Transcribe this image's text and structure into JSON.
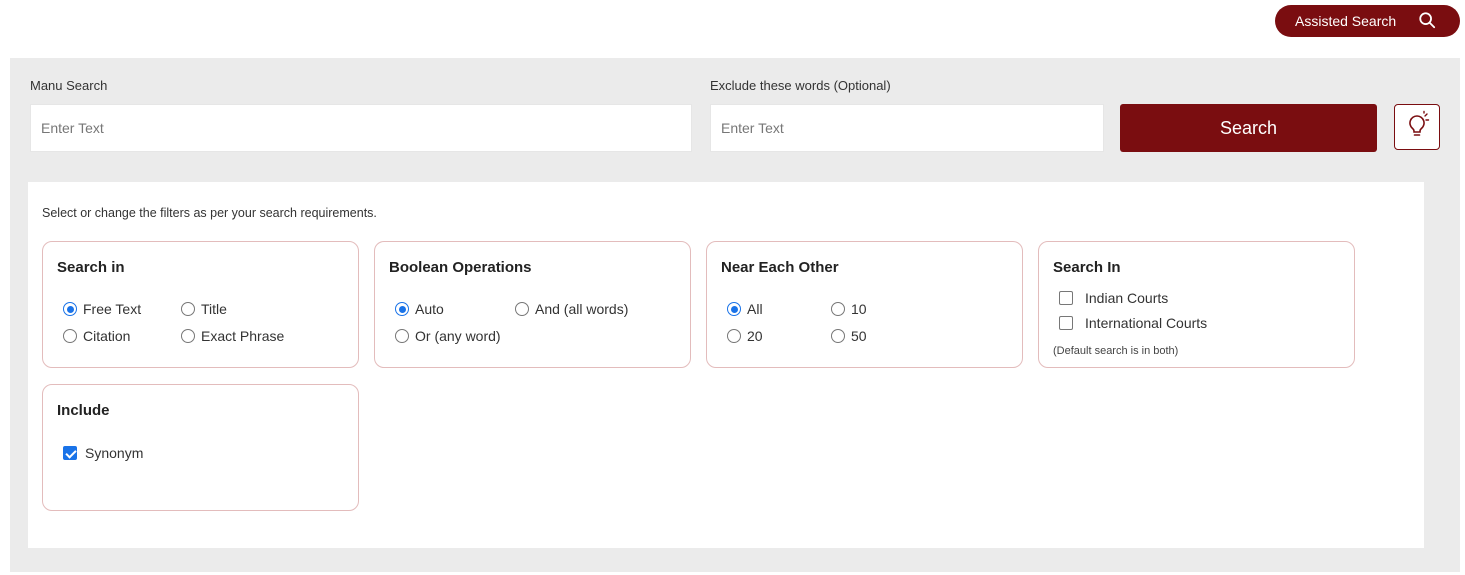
{
  "header": {
    "assisted_search_label": "Assisted Search",
    "assisted_search_icon": "search-icon"
  },
  "search_bar": {
    "main_label": "Manu Search",
    "main_placeholder": "Enter Text",
    "exclude_label": "Exclude these words (Optional)",
    "exclude_placeholder": "Enter Text",
    "search_button_label": "Search",
    "tips_icon": "lightbulb-icon"
  },
  "filters": {
    "note": "Select or change the filters as per your search requirements.",
    "search_in": {
      "title": "Search in",
      "options": [
        {
          "label": "Free Text",
          "selected": true
        },
        {
          "label": "Title",
          "selected": false
        },
        {
          "label": "Citation",
          "selected": false
        },
        {
          "label": "Exact Phrase",
          "selected": false
        }
      ]
    },
    "boolean": {
      "title": "Boolean Operations",
      "options": [
        {
          "label": "Auto",
          "selected": true
        },
        {
          "label": "And (all words)",
          "selected": false
        },
        {
          "label": "Or (any word)",
          "selected": false
        }
      ]
    },
    "near": {
      "title": "Near Each Other",
      "options": [
        {
          "label": "All",
          "selected": true
        },
        {
          "label": "10",
          "selected": false
        },
        {
          "label": "20",
          "selected": false
        },
        {
          "label": "50",
          "selected": false
        }
      ]
    },
    "courts": {
      "title": "Search In",
      "options": [
        {
          "label": "Indian Courts",
          "checked": false
        },
        {
          "label": "International Courts",
          "checked": false
        }
      ],
      "note": "(Default search is in both)"
    },
    "include": {
      "title": "Include",
      "options": [
        {
          "label": "Synonym",
          "checked": true
        }
      ]
    }
  },
  "colors": {
    "brand": "#7a0d10",
    "accent": "#1a73e8",
    "panel_bg": "#ebebeb",
    "card_border": "#e3bcbc"
  }
}
